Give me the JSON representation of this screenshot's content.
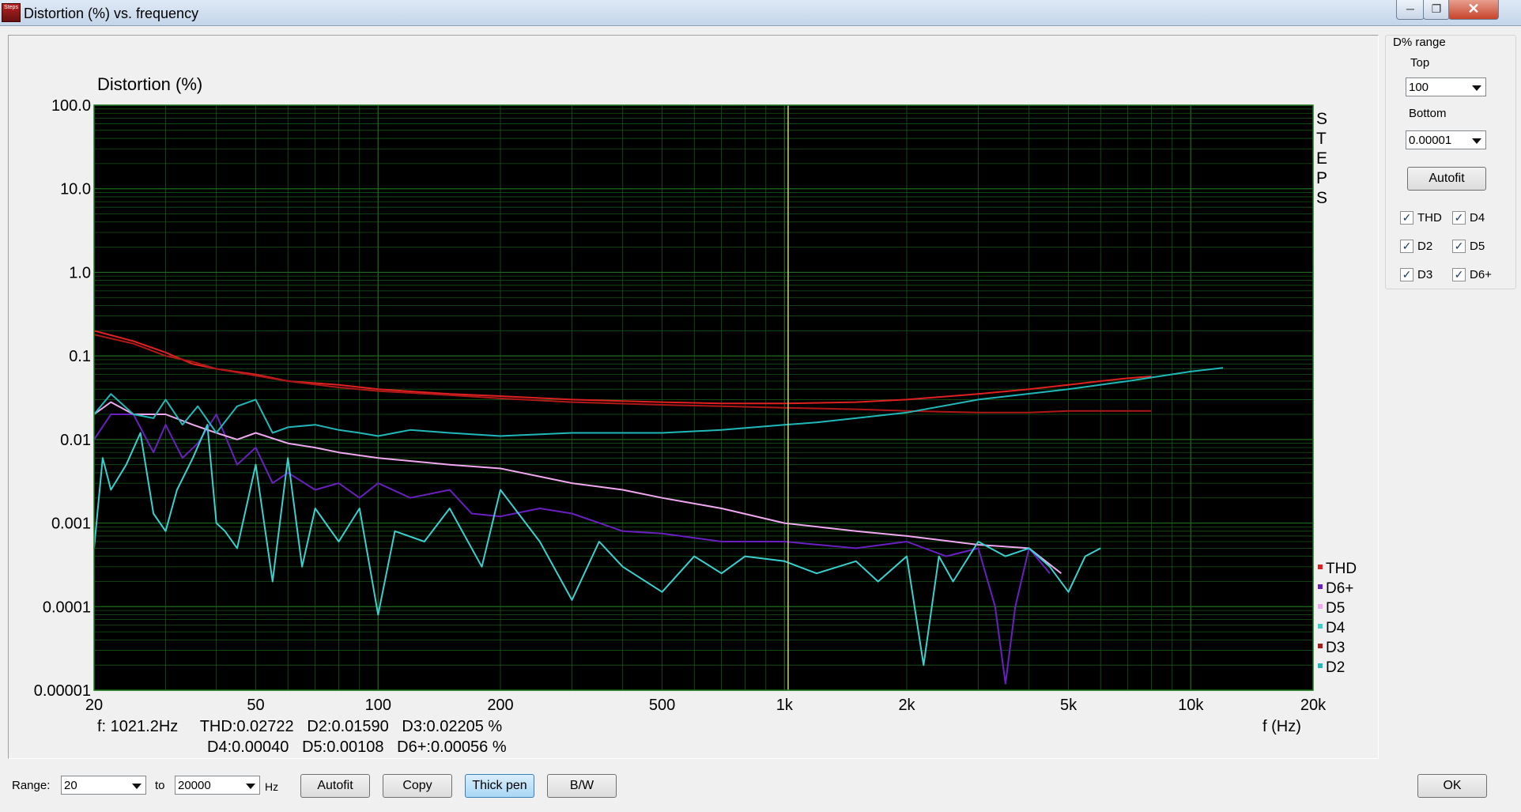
{
  "window": {
    "title": "Distortion (%) vs. frequency",
    "app_icon_text": "Steps"
  },
  "icons": {
    "minimize": "minimize-icon",
    "maximize": "maximize-icon",
    "close": "close-icon",
    "dropdown": "chevron-down-icon",
    "check": "checkmark-icon"
  },
  "chart_data": {
    "type": "line",
    "ylabel": "Distortion (%)",
    "xlabel": "f (Hz)",
    "xscale": "log",
    "yscale": "log",
    "xlim": [
      20,
      20000
    ],
    "ylim": [
      1e-05,
      100
    ],
    "grid": true,
    "background": "#000000",
    "grid_color": "#1d6b1d",
    "cursor": {
      "x": 1021.2,
      "color": "#c8d87a"
    },
    "y_ticks": [
      "100.0",
      "10.0",
      "1.0",
      "0.1",
      "0.01",
      "0.001",
      "0.0001",
      "0.00001"
    ],
    "x_ticks": [
      {
        "value": 20,
        "label": "20"
      },
      {
        "value": 50,
        "label": "50"
      },
      {
        "value": 100,
        "label": "100"
      },
      {
        "value": 200,
        "label": "200"
      },
      {
        "value": 500,
        "label": "500"
      },
      {
        "value": 1000,
        "label": "1k"
      },
      {
        "value": 2000,
        "label": "2k"
      },
      {
        "value": 5000,
        "label": "5k"
      },
      {
        "value": 10000,
        "label": "10k"
      },
      {
        "value": 20000,
        "label": "20k"
      }
    ],
    "side_label": "STEPS",
    "readout": {
      "line1": "f: 1021.2Hz     THD:0.02722   D2:0.01590   D3:0.02205 %",
      "line2": "D4:0.00040   D5:0.00108   D6+:0.00056 %"
    },
    "legend_position": "bottom-right",
    "series": [
      {
        "name": "THD",
        "color": "#e02020",
        "x": [
          20,
          25,
          30,
          35,
          40,
          50,
          60,
          80,
          100,
          150,
          200,
          300,
          500,
          700,
          1000,
          1500,
          2000,
          3000,
          4000,
          5000,
          6000,
          7000,
          8000
        ],
        "y": [
          0.2,
          0.15,
          0.11,
          0.08,
          0.07,
          0.06,
          0.05,
          0.045,
          0.04,
          0.035,
          0.033,
          0.03,
          0.028,
          0.027,
          0.027,
          0.028,
          0.03,
          0.035,
          0.04,
          0.045,
          0.05,
          0.054,
          0.057
        ]
      },
      {
        "name": "D6+",
        "color": "#6a1fc0",
        "x": [
          20,
          22,
          25,
          28,
          30,
          33,
          36,
          40,
          45,
          50,
          55,
          60,
          70,
          80,
          90,
          100,
          120,
          150,
          170,
          200,
          250,
          300,
          400,
          500,
          700,
          1000,
          1500,
          2000,
          2500,
          3000,
          3300,
          3500,
          3700,
          4000,
          4500
        ],
        "y": [
          0.01,
          0.02,
          0.02,
          0.007,
          0.015,
          0.006,
          0.009,
          0.02,
          0.005,
          0.008,
          0.003,
          0.004,
          0.0025,
          0.003,
          0.002,
          0.003,
          0.002,
          0.0025,
          0.0013,
          0.0012,
          0.0015,
          0.0013,
          0.0008,
          0.00075,
          0.0006,
          0.0006,
          0.0005,
          0.0006,
          0.0004,
          0.0005,
          0.0001,
          1.2e-05,
          0.0001,
          0.0005,
          0.00025
        ]
      },
      {
        "name": "D5",
        "color": "#f0a8f0",
        "x": [
          20,
          22,
          25,
          30,
          35,
          40,
          45,
          50,
          60,
          70,
          80,
          100,
          150,
          200,
          300,
          400,
          500,
          700,
          1000,
          1500,
          2000,
          3000,
          4000,
          4800
        ],
        "y": [
          0.02,
          0.028,
          0.02,
          0.02,
          0.015,
          0.012,
          0.01,
          0.012,
          0.009,
          0.008,
          0.007,
          0.006,
          0.005,
          0.0045,
          0.003,
          0.0025,
          0.002,
          0.0015,
          0.001,
          0.0008,
          0.0007,
          0.00055,
          0.0005,
          0.00025
        ]
      },
      {
        "name": "D4",
        "color": "#3ad0d0",
        "x": [
          20,
          21,
          22,
          24,
          26,
          28,
          30,
          32,
          35,
          38,
          40,
          42,
          45,
          50,
          55,
          60,
          65,
          70,
          80,
          90,
          100,
          110,
          130,
          150,
          180,
          200,
          250,
          300,
          350,
          400,
          500,
          600,
          700,
          800,
          1000,
          1200,
          1500,
          1700,
          2000,
          2200,
          2400,
          2600,
          3000,
          3500,
          4000,
          4500,
          5000,
          5500,
          6000
        ],
        "y": [
          0.0005,
          0.006,
          0.0025,
          0.005,
          0.012,
          0.0013,
          0.0008,
          0.0025,
          0.006,
          0.015,
          0.001,
          0.0008,
          0.0005,
          0.005,
          0.0002,
          0.006,
          0.0003,
          0.0015,
          0.0006,
          0.0015,
          8e-05,
          0.0008,
          0.0006,
          0.0015,
          0.0003,
          0.0025,
          0.0006,
          0.00012,
          0.0006,
          0.0003,
          0.00015,
          0.0004,
          0.00025,
          0.0004,
          0.00035,
          0.00025,
          0.00035,
          0.0002,
          0.0004,
          2e-05,
          0.0004,
          0.0002,
          0.0006,
          0.0004,
          0.0005,
          0.0003,
          0.00015,
          0.0004,
          0.0005
        ]
      },
      {
        "name": "D3",
        "color": "#b01818",
        "x": [
          20,
          25,
          30,
          35,
          40,
          50,
          60,
          80,
          100,
          150,
          200,
          300,
          500,
          700,
          1000,
          1500,
          2000,
          3000,
          4000,
          5000,
          6000,
          7000,
          8000
        ],
        "y": [
          0.18,
          0.14,
          0.1,
          0.085,
          0.07,
          0.058,
          0.05,
          0.042,
          0.038,
          0.034,
          0.031,
          0.028,
          0.026,
          0.025,
          0.024,
          0.023,
          0.022,
          0.021,
          0.021,
          0.022,
          0.022,
          0.022,
          0.022
        ]
      },
      {
        "name": "D2",
        "color": "#20b8b8",
        "x": [
          20,
          22,
          25,
          28,
          30,
          33,
          36,
          40,
          45,
          50,
          55,
          60,
          70,
          80,
          90,
          100,
          120,
          150,
          200,
          300,
          500,
          700,
          1000,
          1200,
          1500,
          2000,
          3000,
          5000,
          7000,
          10000,
          12000
        ],
        "y": [
          0.02,
          0.035,
          0.02,
          0.018,
          0.03,
          0.015,
          0.025,
          0.012,
          0.025,
          0.03,
          0.012,
          0.014,
          0.015,
          0.013,
          0.012,
          0.011,
          0.013,
          0.012,
          0.011,
          0.012,
          0.012,
          0.013,
          0.015,
          0.016,
          0.018,
          0.021,
          0.03,
          0.04,
          0.05,
          0.065,
          0.072
        ]
      }
    ]
  },
  "right_panel": {
    "group_title": "D% range",
    "top_label": "Top",
    "top_value": "100",
    "bottom_label": "Bottom",
    "bottom_value": "0.00001",
    "autofit_label": "Autofit",
    "checkboxes": [
      {
        "label": "THD",
        "checked": true
      },
      {
        "label": "D4",
        "checked": true
      },
      {
        "label": "D2",
        "checked": true
      },
      {
        "label": "D5",
        "checked": true
      },
      {
        "label": "D3",
        "checked": true
      },
      {
        "label": "D6+",
        "checked": true
      }
    ]
  },
  "bottom_bar": {
    "range_label": "Range:",
    "range_from": "20",
    "to_label": "to",
    "range_to": "20000",
    "hz_label": "Hz",
    "autofit_label": "Autofit",
    "copy_label": "Copy",
    "thick_pen_label": "Thick pen",
    "thick_pen_active": true,
    "bw_label": "B/W",
    "ok_label": "OK"
  }
}
